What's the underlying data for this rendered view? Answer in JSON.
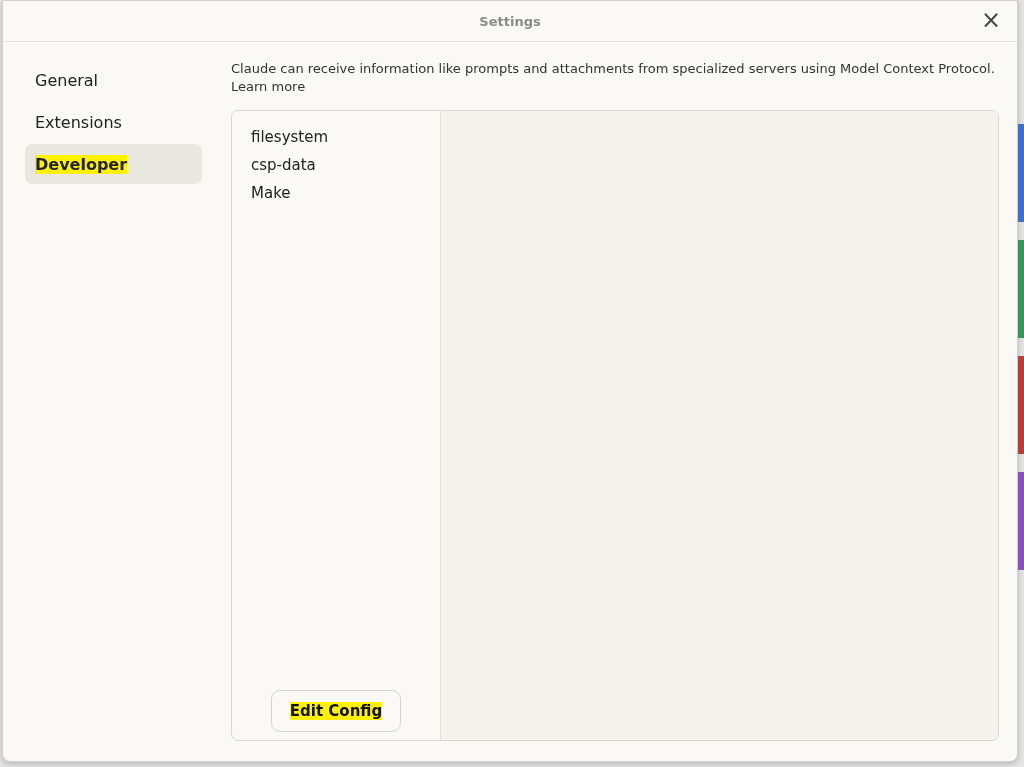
{
  "window": {
    "title": "Settings",
    "close": "×"
  },
  "sidebar": {
    "items": [
      {
        "label": "General",
        "selected": false,
        "highlighted": false
      },
      {
        "label": "Extensions",
        "selected": false,
        "highlighted": false
      },
      {
        "label": "Developer",
        "selected": true,
        "highlighted": true
      }
    ]
  },
  "description": {
    "text": "Claude can receive information like prompts and attachments from specialized servers using Model Context Protocol.",
    "link": "Learn more"
  },
  "servers": [
    {
      "name": "filesystem",
      "selected": false
    },
    {
      "name": "csp-data",
      "selected": false
    },
    {
      "name": "Make",
      "selected": false
    }
  ],
  "edit_button": {
    "label": "Edit Config",
    "highlighted": true
  },
  "background_strips": [
    {
      "color": "#3b6fd1"
    },
    {
      "color": "#2e9a5a"
    },
    {
      "color": "#c23a35"
    },
    {
      "color": "#8a4fc8"
    }
  ]
}
